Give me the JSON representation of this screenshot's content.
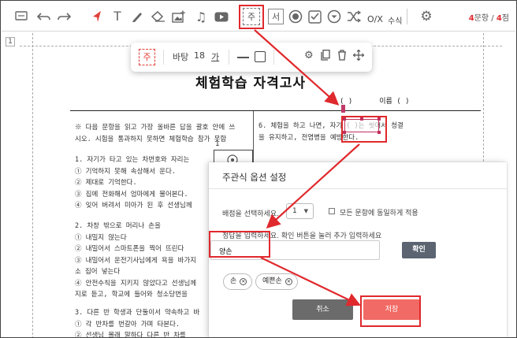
{
  "toolbar": {
    "tools": [
      {
        "name": "comment-tool",
        "icon": "comment-icon"
      },
      {
        "name": "undo",
        "icon": "undo-icon"
      },
      {
        "name": "redo",
        "icon": "redo-icon"
      },
      {
        "name": "pointer",
        "icon": "pointer-icon"
      },
      {
        "name": "text",
        "icon": "text-icon",
        "glyph": "T"
      },
      {
        "name": "pen",
        "icon": "pen-icon"
      },
      {
        "name": "eraser",
        "icon": "eraser-icon"
      },
      {
        "name": "image",
        "icon": "image-add-icon"
      },
      {
        "name": "audio",
        "icon": "music-icon"
      },
      {
        "name": "video",
        "icon": "video-icon"
      },
      {
        "name": "short-answer",
        "icon": "short-answer-icon",
        "glyph": "주"
      },
      {
        "name": "essay",
        "icon": "essay-icon",
        "glyph": "서"
      },
      {
        "name": "radio",
        "icon": "radio-icon"
      },
      {
        "name": "checkbox",
        "icon": "checkbox-icon"
      },
      {
        "name": "dropdown",
        "icon": "dropdown-icon"
      },
      {
        "name": "shuffle",
        "icon": "shuffle-icon"
      }
    ],
    "ox_label": "O/X",
    "formula_label": "수식",
    "settings_icon": "gear-icon",
    "count_questions": "4",
    "count_questions_unit": "문항",
    "count_separator": " / ",
    "count_points": "4",
    "count_points_unit": "점"
  },
  "page": {
    "page_number": "1",
    "title": "체험학습 자격고사",
    "name_line_open": "(         )",
    "name_label": "이름 (         )",
    "instructions": [
      "※ 다음 문항을 읽고 가장 올바른 답을 괄호 안에 쓰",
      "시오. 시험을 통과하지 못하면 체험학습 참가 못함"
    ],
    "q1": [
      "1. 자기가 타고 있는 차번호와 자리는",
      "① 기억하지 못해 속상해서 운다.",
      "② 제대로 기억한다.",
      "③ 집에 전화해서 엄마에게 물어본다.",
      "④ 잊어 버려서 미아가 된 후 선생님께"
    ],
    "q2": [
      "2. 차창 밖으로 머리나 손을",
      "① 내밀지 않는다",
      "② 내밀어서 스마트폰을 찍어 뜨린다",
      "③ 내밀어서 운전기사님에게 욕을 바가지",
      "   소 집어 넣는다",
      "④ 안전수칙을 지키지 않았다고 선생님께",
      "   지로 듣고, 학교에 들어와 청소당번을"
    ],
    "q3": [
      "3. 다른 반 학생과 단둘이서 약속하고 바",
      "① 각 반차를 번갈아 가며 타본다.",
      "② 선생님 몰래 말하다 다른 반 차를"
    ],
    "q6": [
      "6. 체험을 하고 나면, 자기 (      )는 씻어서 청결",
      "을 유지하고, 전염병을 예방한다."
    ],
    "image_number": "1"
  },
  "float_bar": {
    "icon": "short-answer-icon",
    "icon_glyph": "주",
    "font_name": "바탕",
    "font_size": "18",
    "font_glyph": "가",
    "icons": [
      "line-icon",
      "square-icon",
      "gear-icon",
      "copy-icon",
      "trash-icon",
      "move-icon"
    ]
  },
  "dialog": {
    "title": "주관식 옵션 설정",
    "score_label": "배점을 선택하세요.",
    "score_value": "1",
    "apply_all_label": "모든 문항에 동일하게 적용",
    "answer_label": "정답을 입력하세요. 확인 버튼을 눌러 추가 입력하세요",
    "answer_value": "양손",
    "confirm_label": "확인",
    "chips": [
      "손",
      "예쁜손"
    ],
    "cancel_label": "취소",
    "save_label": "저장"
  },
  "colors": {
    "highlight_red": "#e0292d",
    "save_button": "#f26a65",
    "cancel_button": "#6b6b6b",
    "confirm_button": "#5b6470"
  }
}
